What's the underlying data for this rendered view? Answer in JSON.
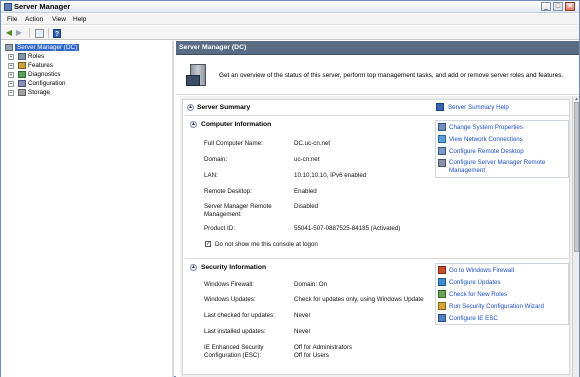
{
  "window": {
    "title": "Server Manager"
  },
  "menu": [
    "File",
    "Action",
    "View",
    "Help"
  ],
  "tree": {
    "root": "Server Manager (DC)",
    "items": [
      "Roles",
      "Features",
      "Diagnostics",
      "Configuration",
      "Storage"
    ]
  },
  "content": {
    "header": "Server Manager (DC)",
    "intro": "Get an overview of the status of this server, perform top management tasks, and add or remove server roles and features."
  },
  "summary": {
    "title": "Server Summary",
    "help_link": "Server Summary Help",
    "computer_info": {
      "title": "Computer Information",
      "fields": [
        {
          "label": "Full Computer Name:",
          "value": "DC.uc-cn.net"
        },
        {
          "label": "Domain:",
          "value": "uc-cn.net"
        },
        {
          "label": "LAN:",
          "value": "10.10.10.10, IPv6 enabled"
        },
        {
          "label": "Remote Desktop:",
          "value": "Enabled"
        },
        {
          "label": "Server Manager Remote Management:",
          "value": "Disabled"
        },
        {
          "label": "Product ID:",
          "value": "55041-507-0887525-84185 (Activated)"
        }
      ],
      "tasks": [
        "Change System Properties",
        "View Network Connections",
        "Configure Remote Desktop",
        "Configure Server Manager Remote Management"
      ],
      "checkbox_label": "Do not show me this console at logon"
    },
    "security_info": {
      "title": "Security Information",
      "fields": [
        {
          "label": "Windows Firewall:",
          "value": "Domain: On"
        },
        {
          "label": "Windows Updates:",
          "value": "Check for updates only, using Windows Update"
        },
        {
          "label": "Last checked for updates:",
          "value": "Never"
        },
        {
          "label": "Last installed updates:",
          "value": "Never"
        },
        {
          "label": "IE Enhanced Security Configuration (ESC):",
          "value": "Off for Administrators Off for Users"
        }
      ],
      "tasks": [
        "Go to Windows Firewall",
        "Configure Updates",
        "Check for New Roles",
        "Run Security Configuration Wizard",
        "Configure IE ESC"
      ]
    }
  },
  "colors": {
    "link": "#1f4fc5",
    "header_bg": "#5a6c84",
    "tree_selection": "#3169c6"
  }
}
